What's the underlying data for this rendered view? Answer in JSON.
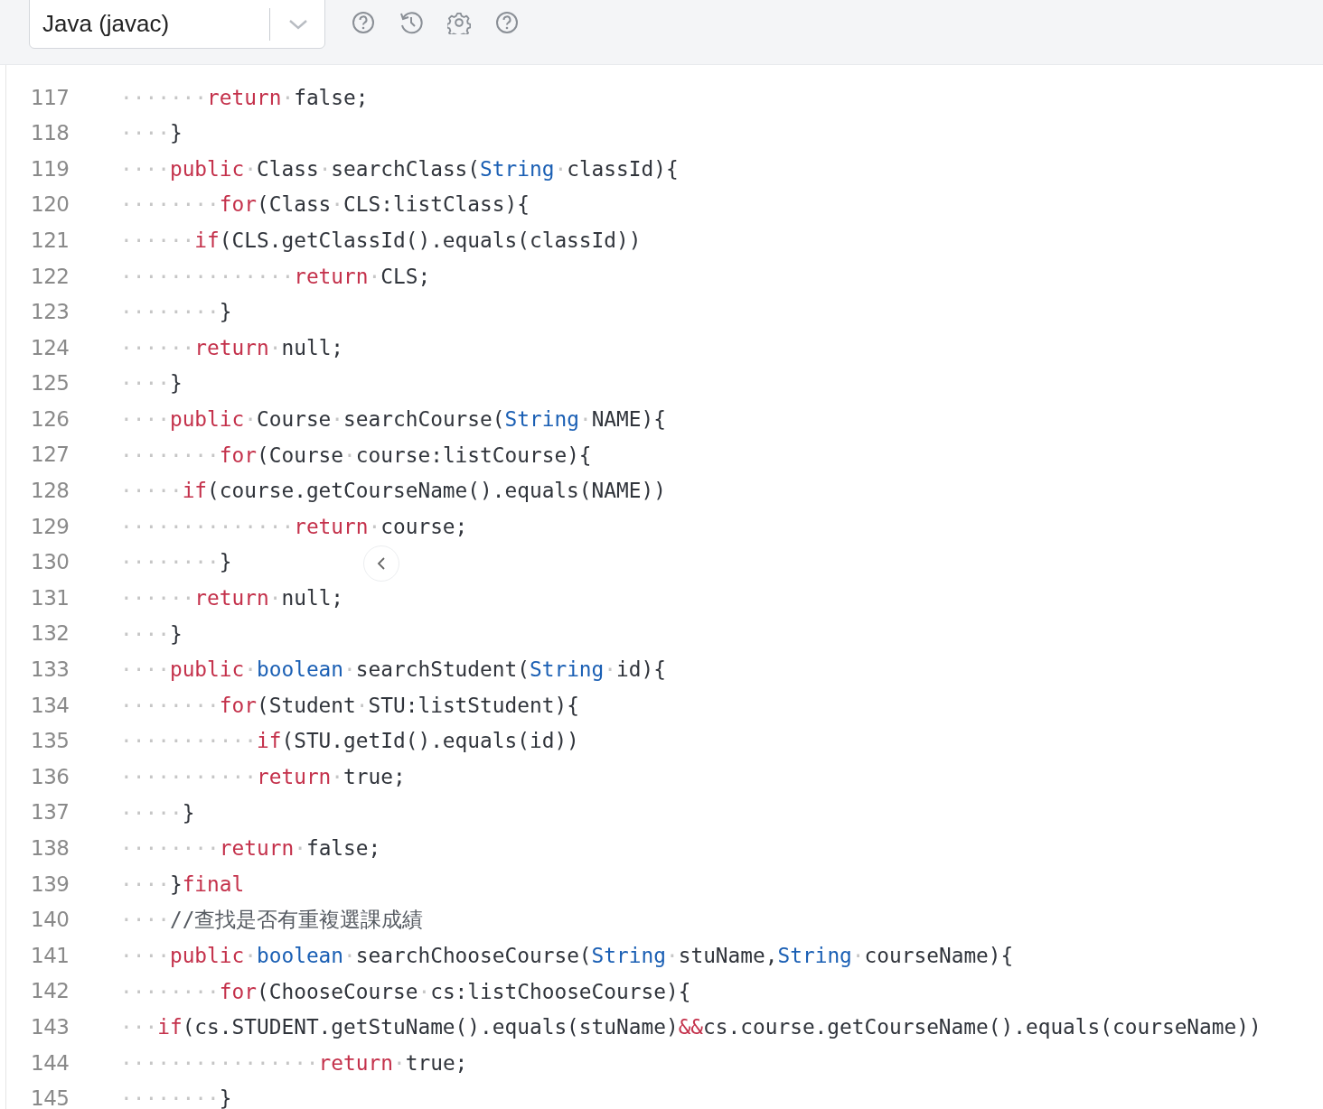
{
  "toolbar": {
    "language_select": {
      "value": "Java (javac)"
    },
    "icons": [
      {
        "kind": "help"
      },
      {
        "kind": "history"
      },
      {
        "kind": "settings"
      },
      {
        "kind": "help"
      }
    ]
  },
  "editor": {
    "lines": [
      {
        "number": "117",
        "tokens": [
          {
            "kind": "ws",
            "text": "·······"
          },
          {
            "kind": "keyword",
            "text": "return"
          },
          {
            "kind": "ws",
            "text": "·"
          },
          {
            "kind": "plain",
            "text": "false;"
          }
        ]
      },
      {
        "number": "118",
        "tokens": [
          {
            "kind": "ws",
            "text": "····"
          },
          {
            "kind": "plain",
            "text": "}"
          }
        ]
      },
      {
        "number": "119",
        "tokens": [
          {
            "kind": "ws",
            "text": "····"
          },
          {
            "kind": "keyword",
            "text": "public"
          },
          {
            "kind": "ws",
            "text": "·"
          },
          {
            "kind": "plain",
            "text": "Class"
          },
          {
            "kind": "ws",
            "text": "·"
          },
          {
            "kind": "plain",
            "text": "searchClass("
          },
          {
            "kind": "type",
            "text": "String"
          },
          {
            "kind": "ws",
            "text": "·"
          },
          {
            "kind": "plain",
            "text": "classId){"
          }
        ]
      },
      {
        "number": "120",
        "tokens": [
          {
            "kind": "ws",
            "text": "········"
          },
          {
            "kind": "keyword",
            "text": "for"
          },
          {
            "kind": "plain",
            "text": "(Class"
          },
          {
            "kind": "ws",
            "text": "·"
          },
          {
            "kind": "plain",
            "text": "CLS:listClass){"
          }
        ]
      },
      {
        "number": "121",
        "tokens": [
          {
            "kind": "ws",
            "text": "······"
          },
          {
            "kind": "keyword",
            "text": "if"
          },
          {
            "kind": "plain",
            "text": "(CLS.getClassId().equals(classId))"
          }
        ]
      },
      {
        "number": "122",
        "tokens": [
          {
            "kind": "ws",
            "text": "··············"
          },
          {
            "kind": "keyword",
            "text": "return"
          },
          {
            "kind": "ws",
            "text": "·"
          },
          {
            "kind": "plain",
            "text": "CLS;"
          }
        ]
      },
      {
        "number": "123",
        "tokens": [
          {
            "kind": "ws",
            "text": "········"
          },
          {
            "kind": "plain",
            "text": "}"
          }
        ]
      },
      {
        "number": "124",
        "tokens": [
          {
            "kind": "ws",
            "text": "······"
          },
          {
            "kind": "keyword",
            "text": "return"
          },
          {
            "kind": "ws",
            "text": "·"
          },
          {
            "kind": "plain",
            "text": "null;"
          }
        ]
      },
      {
        "number": "125",
        "tokens": [
          {
            "kind": "ws",
            "text": "····"
          },
          {
            "kind": "plain",
            "text": "}"
          }
        ]
      },
      {
        "number": "126",
        "tokens": [
          {
            "kind": "ws",
            "text": "····"
          },
          {
            "kind": "keyword",
            "text": "public"
          },
          {
            "kind": "ws",
            "text": "·"
          },
          {
            "kind": "plain",
            "text": "Course"
          },
          {
            "kind": "ws",
            "text": "·"
          },
          {
            "kind": "plain",
            "text": "searchCourse("
          },
          {
            "kind": "type",
            "text": "String"
          },
          {
            "kind": "ws",
            "text": "·"
          },
          {
            "kind": "plain",
            "text": "NAME){"
          }
        ]
      },
      {
        "number": "127",
        "tokens": [
          {
            "kind": "ws",
            "text": "········"
          },
          {
            "kind": "keyword",
            "text": "for"
          },
          {
            "kind": "plain",
            "text": "(Course"
          },
          {
            "kind": "ws",
            "text": "·"
          },
          {
            "kind": "plain",
            "text": "course:listCourse){"
          }
        ]
      },
      {
        "number": "128",
        "tokens": [
          {
            "kind": "ws",
            "text": "·····"
          },
          {
            "kind": "keyword",
            "text": "if"
          },
          {
            "kind": "plain",
            "text": "(course.getCourseName().equals(NAME))"
          }
        ]
      },
      {
        "number": "129",
        "tokens": [
          {
            "kind": "ws",
            "text": "··············"
          },
          {
            "kind": "keyword",
            "text": "return"
          },
          {
            "kind": "ws",
            "text": "·"
          },
          {
            "kind": "plain",
            "text": "course;"
          }
        ]
      },
      {
        "number": "130",
        "tokens": [
          {
            "kind": "ws",
            "text": "········"
          },
          {
            "kind": "plain",
            "text": "}"
          }
        ]
      },
      {
        "number": "131",
        "tokens": [
          {
            "kind": "ws",
            "text": "······"
          },
          {
            "kind": "keyword",
            "text": "return"
          },
          {
            "kind": "ws",
            "text": "·"
          },
          {
            "kind": "plain",
            "text": "null;"
          }
        ]
      },
      {
        "number": "132",
        "tokens": [
          {
            "kind": "ws",
            "text": "····"
          },
          {
            "kind": "plain",
            "text": "}"
          }
        ]
      },
      {
        "number": "133",
        "tokens": [
          {
            "kind": "ws",
            "text": "····"
          },
          {
            "kind": "keyword",
            "text": "public"
          },
          {
            "kind": "ws",
            "text": "·"
          },
          {
            "kind": "type",
            "text": "boolean"
          },
          {
            "kind": "ws",
            "text": "·"
          },
          {
            "kind": "plain",
            "text": "searchStudent("
          },
          {
            "kind": "type",
            "text": "String"
          },
          {
            "kind": "ws",
            "text": "·"
          },
          {
            "kind": "plain",
            "text": "id){"
          }
        ]
      },
      {
        "number": "134",
        "tokens": [
          {
            "kind": "ws",
            "text": "········"
          },
          {
            "kind": "keyword",
            "text": "for"
          },
          {
            "kind": "plain",
            "text": "(Student"
          },
          {
            "kind": "ws",
            "text": "·"
          },
          {
            "kind": "plain",
            "text": "STU:listStudent){"
          }
        ]
      },
      {
        "number": "135",
        "tokens": [
          {
            "kind": "ws",
            "text": "···········"
          },
          {
            "kind": "keyword",
            "text": "if"
          },
          {
            "kind": "plain",
            "text": "(STU.getId().equals(id))"
          }
        ]
      },
      {
        "number": "136",
        "tokens": [
          {
            "kind": "ws",
            "text": "···········"
          },
          {
            "kind": "keyword",
            "text": "return"
          },
          {
            "kind": "ws",
            "text": "·"
          },
          {
            "kind": "plain",
            "text": "true;"
          }
        ]
      },
      {
        "number": "137",
        "tokens": [
          {
            "kind": "ws",
            "text": "·····"
          },
          {
            "kind": "plain",
            "text": "}"
          }
        ]
      },
      {
        "number": "138",
        "tokens": [
          {
            "kind": "ws",
            "text": "········"
          },
          {
            "kind": "keyword",
            "text": "return"
          },
          {
            "kind": "ws",
            "text": "·"
          },
          {
            "kind": "plain",
            "text": "false;"
          }
        ]
      },
      {
        "number": "139",
        "tokens": [
          {
            "kind": "ws",
            "text": "····"
          },
          {
            "kind": "plain",
            "text": "}"
          },
          {
            "kind": "keyword",
            "text": "final"
          }
        ]
      },
      {
        "number": "140",
        "tokens": [
          {
            "kind": "ws",
            "text": "····"
          },
          {
            "kind": "comment",
            "text": "//查找是否有重複選課成績"
          }
        ]
      },
      {
        "number": "141",
        "tokens": [
          {
            "kind": "ws",
            "text": "····"
          },
          {
            "kind": "keyword",
            "text": "public"
          },
          {
            "kind": "ws",
            "text": "·"
          },
          {
            "kind": "type",
            "text": "boolean"
          },
          {
            "kind": "ws",
            "text": "·"
          },
          {
            "kind": "plain",
            "text": "searchChooseCourse("
          },
          {
            "kind": "type",
            "text": "String"
          },
          {
            "kind": "ws",
            "text": "·"
          },
          {
            "kind": "plain",
            "text": "stuName,"
          },
          {
            "kind": "type",
            "text": "String"
          },
          {
            "kind": "ws",
            "text": "·"
          },
          {
            "kind": "plain",
            "text": "courseName){"
          }
        ]
      },
      {
        "number": "142",
        "tokens": [
          {
            "kind": "ws",
            "text": "········"
          },
          {
            "kind": "keyword",
            "text": "for"
          },
          {
            "kind": "plain",
            "text": "(ChooseCourse"
          },
          {
            "kind": "ws",
            "text": "·"
          },
          {
            "kind": "plain",
            "text": "cs:listChooseCourse){"
          }
        ]
      },
      {
        "number": "143",
        "tokens": [
          {
            "kind": "ws",
            "text": "···"
          },
          {
            "kind": "keyword",
            "text": "if"
          },
          {
            "kind": "plain",
            "text": "(cs.STUDENT.getStuName().equals(stuName)"
          },
          {
            "kind": "keyword",
            "text": "&&"
          },
          {
            "kind": "plain",
            "text": "cs.course.getCourseName().equals(courseName))"
          }
        ]
      },
      {
        "number": "144",
        "tokens": [
          {
            "kind": "ws",
            "text": "················"
          },
          {
            "kind": "keyword",
            "text": "return"
          },
          {
            "kind": "ws",
            "text": "·"
          },
          {
            "kind": "plain",
            "text": "true;"
          }
        ]
      },
      {
        "number": "145",
        "tokens": [
          {
            "kind": "ws",
            "text": "········"
          },
          {
            "kind": "plain",
            "text": "}"
          }
        ]
      }
    ]
  }
}
